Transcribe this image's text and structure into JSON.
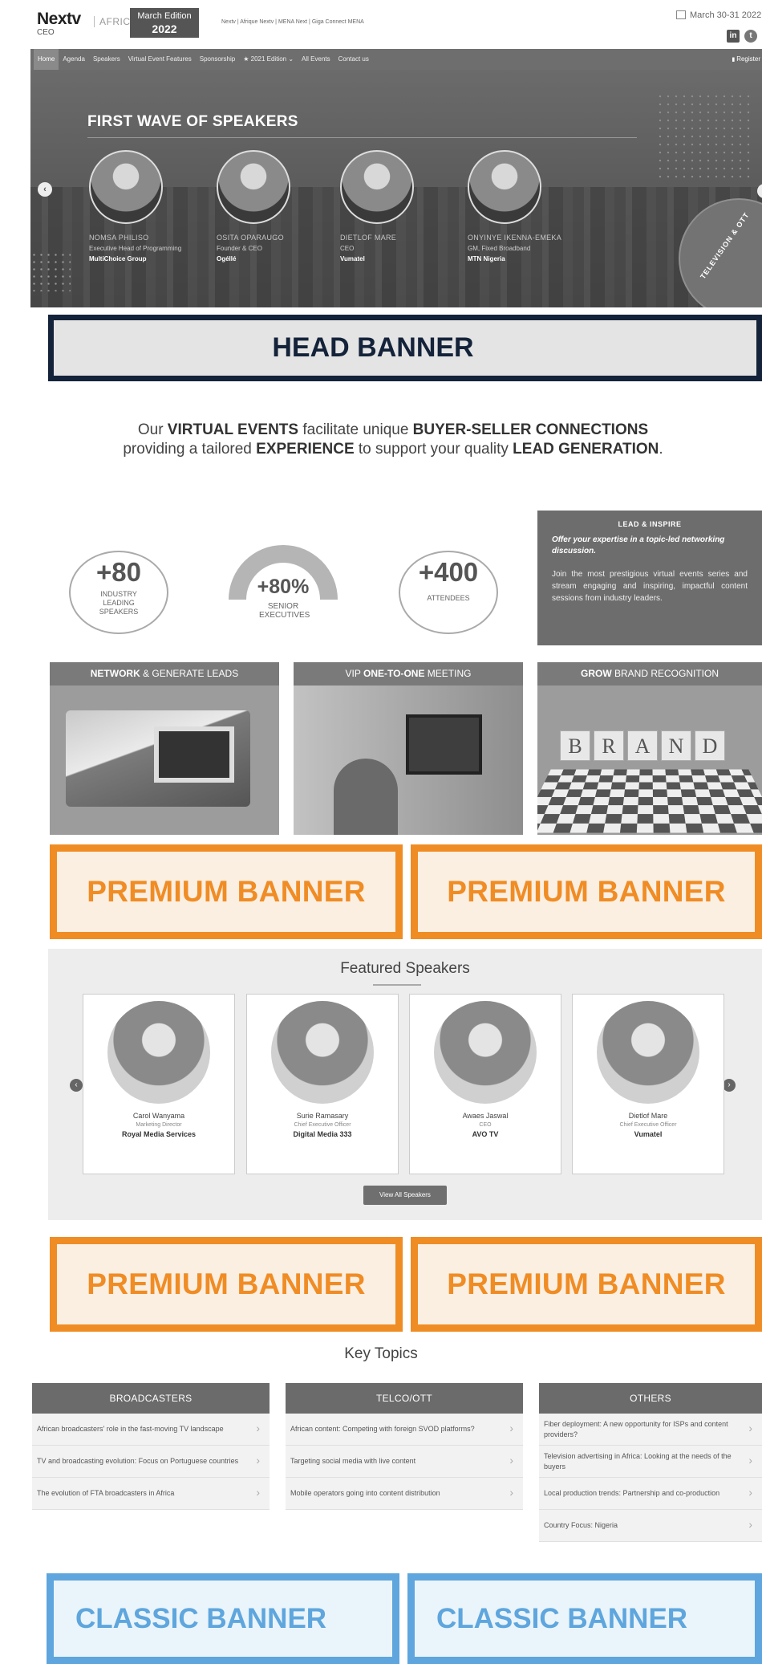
{
  "header": {
    "logo_text": "Nextv",
    "logo_sub": "CEO",
    "logo_region": "AFRICA",
    "edition_line1": "March Edition",
    "edition_line2": "2022",
    "partner_links": "Nextv | Afrique   Nextv | MENA   Next | Giga Connect MENA",
    "event_date": "March 30-31 2022",
    "social": [
      "linkedin-icon",
      "twitter-icon"
    ]
  },
  "nav": {
    "items": [
      "Home",
      "Agenda",
      "Speakers",
      "Virtual Event Features",
      "Sponsorship",
      "★ 2021 Edition ⌄",
      "All Events",
      "Contact us"
    ],
    "register": "Register"
  },
  "hero": {
    "title": "FIRST WAVE OF SPEAKERS",
    "badge_text": "TELEVISION & OTT",
    "speakers": [
      {
        "name": "NOMSA PHILISO",
        "role": "Executive Head of Programming",
        "org": "MultiChoice Group"
      },
      {
        "name": "OSITA OPARAUGO",
        "role": "Founder & CEO",
        "org": "Ogéllé"
      },
      {
        "name": "DIETLOF MARE",
        "role": "CEO",
        "org": "Vumatel"
      },
      {
        "name": "ONYINYE IKENNA-EMEKA",
        "role": "GM, Fixed Broadband",
        "org": "MTN Nigeria"
      }
    ]
  },
  "head_banner": "HEAD BANNER",
  "intro": {
    "p1": "Our ",
    "b1": "VIRTUAL EVENTS",
    "p2": " facilitate unique ",
    "b2": "BUYER-SELLER CONNECTIONS",
    "p3": " providing a tailored ",
    "b3": "EXPERIENCE",
    "p4": " to support your quality ",
    "b4": "LEAD GENERATION",
    "p5": "."
  },
  "stats": {
    "speakers_num": "+80",
    "speakers_label": "INDUSTRY LEADING SPEAKERS",
    "execs_num": "+80%",
    "execs_label": "SENIOR EXECUTIVES",
    "execs_fill": 0.8,
    "attendees_num": "+400",
    "attendees_label": "ATTENDEES"
  },
  "lead_box": {
    "title": "LEAD & INSPIRE",
    "intro": "Offer your expertise in a topic-led networking discussion.",
    "body": "Join the most prestigious virtual events series and stream engaging and inspiring, impactful content sessions from industry leaders."
  },
  "features": [
    {
      "bold": "NETWORK",
      "rest": " & GENERATE LEADS"
    },
    {
      "pre": "VIP ",
      "bold": "ONE-TO-ONE",
      "rest": " MEETING"
    },
    {
      "bold": "GROW",
      "rest": " BRAND RECOGNITION"
    }
  ],
  "brand_letters": [
    "B",
    "R",
    "A",
    "N",
    "D"
  ],
  "premium_banner": "PREMIUM BANNER",
  "featured": {
    "title": "Featured Speakers",
    "speakers": [
      {
        "name": "Carol Wanyama",
        "role": "Marketing Director",
        "org": "Royal Media Services"
      },
      {
        "name": "Surie Ramasary",
        "role": "Chief Executive Officer",
        "org": "Digital Media 333"
      },
      {
        "name": "Awaes Jaswal",
        "role": "CEO",
        "org": "AVO TV"
      },
      {
        "name": "Dietlof Mare",
        "role": "Chief Executive Officer",
        "org": "Vumatel"
      }
    ],
    "view_all": "View All Speakers"
  },
  "key_topics": {
    "title": "Key Topics",
    "columns": [
      {
        "head": "BROADCASTERS",
        "items": [
          "African broadcasters' role in the fast-moving TV landscape",
          "TV and broadcasting evolution: Focus on Portuguese countries",
          "The evolution of FTA broadcasters in Africa"
        ]
      },
      {
        "head": "TELCO/OTT",
        "items": [
          "African content: Competing with foreign SVOD platforms?",
          "Targeting social media with live content",
          "Mobile operators going into content distribution"
        ]
      },
      {
        "head": "OTHERS",
        "items": [
          "Fiber deployment: A new opportunity for ISPs and content providers?",
          "Television advertising in Africa: Looking at the needs of the buyers",
          "Local production trends: Partnership and co-production",
          "Country Focus: Nigeria"
        ]
      }
    ]
  },
  "classic_banner": "CLASSIC BANNER",
  "colors": {
    "premium": "#f08c24",
    "classic": "#5ea6dd",
    "head_banner": "#14233a"
  }
}
